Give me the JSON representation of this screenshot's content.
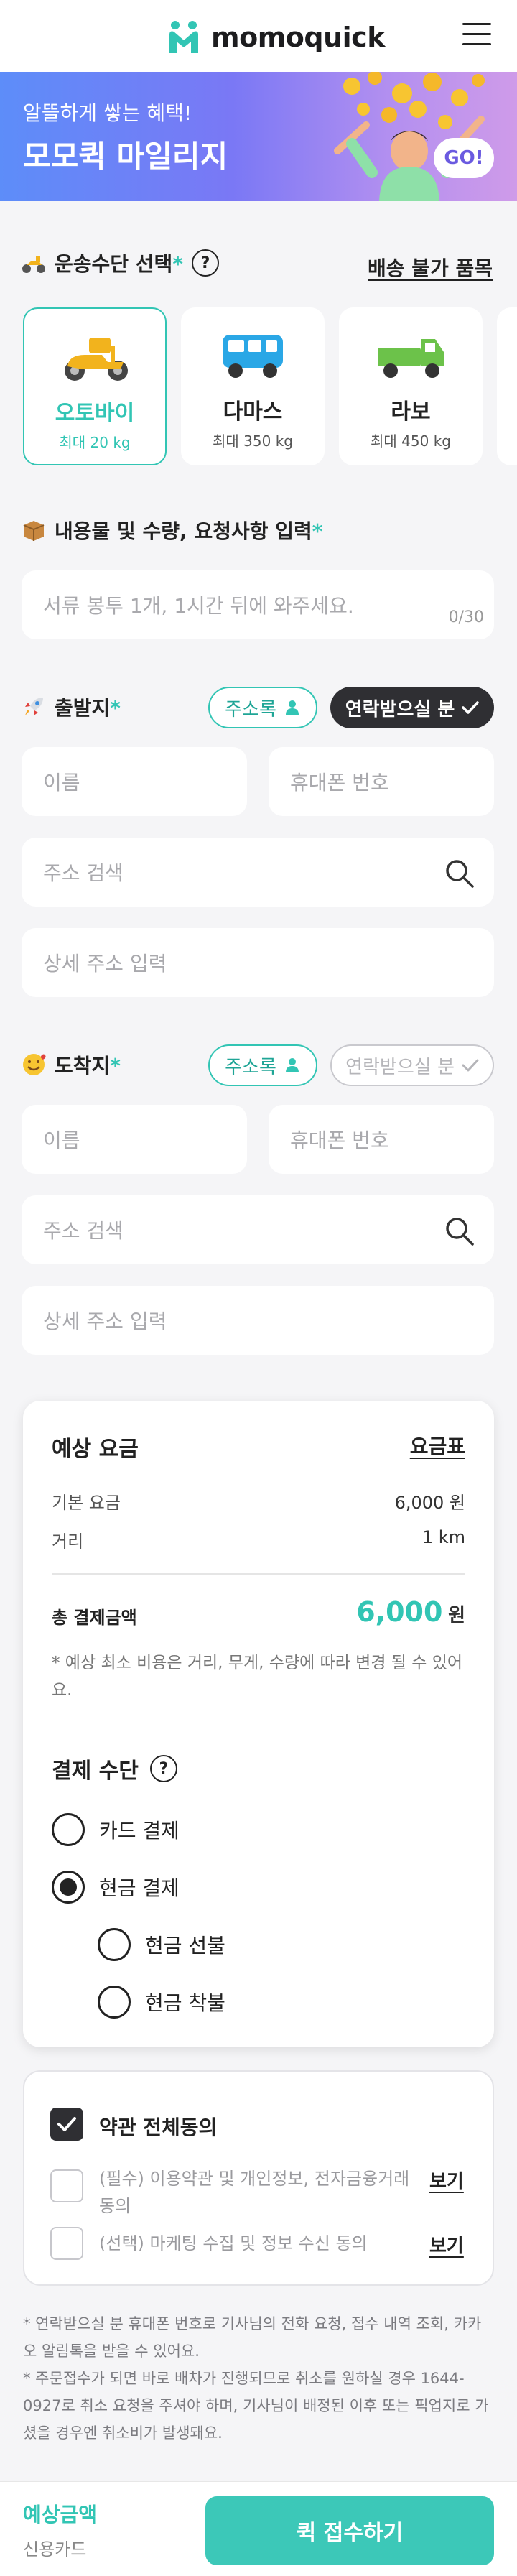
{
  "header": {
    "logo_text": "momoquick",
    "menu_icon": "hamburger-menu-icon"
  },
  "banner": {
    "subtitle": "알뜰하게 쌓는 혜택!",
    "title": "모모퀵 마일리지",
    "go_label": "GO!"
  },
  "vehicle_section": {
    "title": "운송수단 선택",
    "required_mark": "*",
    "help_icon": "question-circle-icon",
    "link": "배송 불가 품목",
    "vehicles": [
      {
        "name": "오토바이",
        "max": "최대 20 kg",
        "icon": "scooter-icon",
        "selected": true
      },
      {
        "name": "다마스",
        "max": "최대 350 kg",
        "icon": "van-icon",
        "selected": false
      },
      {
        "name": "라보",
        "max": "최대 450 kg",
        "icon": "truck-icon",
        "selected": false
      }
    ]
  },
  "item_section": {
    "title": "내용물 및 수량, 요청사항 입력",
    "required_mark": "*",
    "placeholder": "서류 봉투 1개, 1시간 뒤에 와주세요.",
    "counter": "0/30"
  },
  "origin": {
    "title": "출발지",
    "required_mark": "*",
    "address_book": "주소록",
    "contact_toggle": "연락받으실 분",
    "contact_selected": true,
    "name_placeholder": "이름",
    "phone_placeholder": "휴대폰 번호",
    "search_placeholder": "주소 검색",
    "detail_placeholder": "상세 주소 입력"
  },
  "destination": {
    "title": "도착지",
    "required_mark": "*",
    "address_book": "주소록",
    "contact_toggle": "연락받으실 분",
    "contact_selected": false,
    "name_placeholder": "이름",
    "phone_placeholder": "휴대폰 번호",
    "search_placeholder": "주소 검색",
    "detail_placeholder": "상세 주소 입력"
  },
  "fare": {
    "title": "예상 요금",
    "table_link": "요금표",
    "rows": [
      {
        "label": "기본 요금",
        "value": "6,000 원"
      },
      {
        "label": "거리",
        "value": "1 km"
      }
    ],
    "total_label": "총 결제금액",
    "total_value": "6,000",
    "total_unit": "원",
    "note": "* 예상 최소 비용은 거리, 무게, 수량에 따라 변경 될 수 있어요.",
    "payment_title": "결제 수단",
    "payment_options": [
      {
        "label": "카드 결제",
        "selected": false
      },
      {
        "label": "현금 결제",
        "selected": true
      }
    ],
    "cash_options": [
      {
        "label": "현금 선불",
        "selected": false
      },
      {
        "label": "현금 착불",
        "selected": false
      }
    ]
  },
  "terms": {
    "all_label": "약관 전체동의",
    "all_checked": true,
    "items": [
      {
        "label": "(필수) 이용약관 및 개인정보, 전자금융거래 동의",
        "link": "보기",
        "checked": false
      },
      {
        "label": "(선택) 마케팅 수집 및 정보 수신 동의",
        "link": "보기",
        "checked": false
      }
    ]
  },
  "footnote": "* 연락받으실 분 휴대폰 번호로 기사님의 전화 요청, 접수 내역 조회, 카카오 알림톡을 받을 수 있어요.\n* 주문접수가 되면 바로 배차가 진행되므로 취소를 원하실 경우 1644-0927로 취소 요청을 주셔야 하며, 기사님이 배정된 이후 또는 픽업지로 가셨을 경우엔 취소비가 발생돼요.",
  "bottom_bar": {
    "estimate_label": "예상금액",
    "payment_label": "신용카드",
    "submit_label": "퀵 접수하기"
  },
  "colors": {
    "accent": "#32c5b4",
    "dark": "#2f2f33",
    "banner_start": "#5d8df9",
    "banner_end": "#cf9be9"
  }
}
